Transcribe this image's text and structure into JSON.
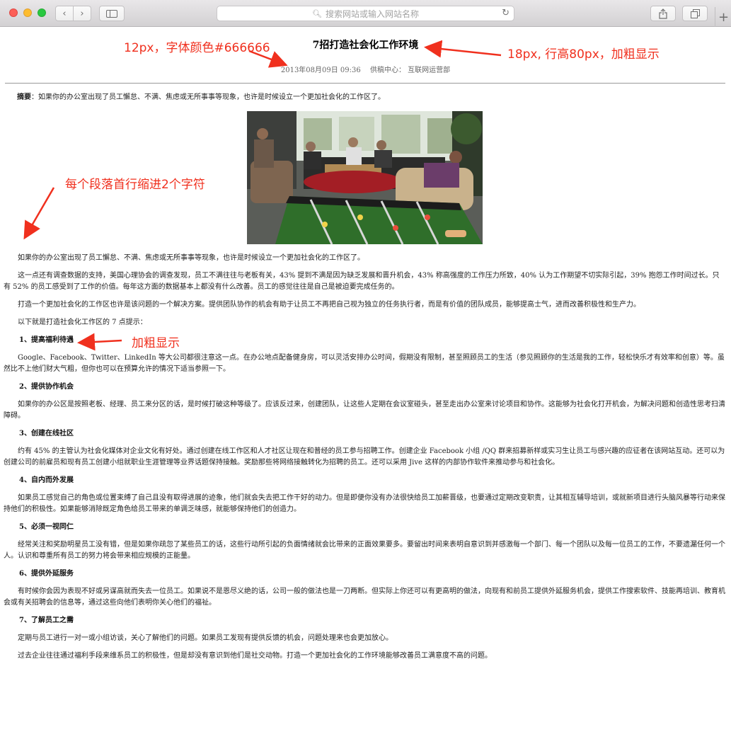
{
  "browser": {
    "url_placeholder": "搜索网站或输入网站名称",
    "icons": [
      "back-icon",
      "forward-icon",
      "sidebar-icon",
      "search-icon",
      "reload-icon",
      "share-icon",
      "tabs-icon",
      "plus-icon"
    ]
  },
  "article": {
    "title": "7招打造社会化工作环境",
    "date": "2013年08月09日 09:36",
    "source": "供稿中心：  互联网运营部",
    "abstract_label": "摘要",
    "abstract_text": "：如果你的办公室出现了员工懈怠、不满、焦虑或无所事事等现象，也许是时候设立一个更加社会化的工作区了。",
    "intro": [
      "如果你的办公室出现了员工懈怠、不满、焦虑或无所事事等现象，也许是时候设立一个更加社会化的工作区了。",
      "这一点还有调查数据的支持，美国心理协会的调查发现，员工不满往往与老板有关，43% 提到不满是因为缺乏发展和晋升机会，43% 称高强度的工作压力所致，40% 认为工作期望不切实际引起，39% 抱怨工作时间过长。只有 52% 的员工感受到了工作的价值。每年这方面的数据基本上都没有什么改善。员工的感觉往往是自己是被迫要完成任务的。",
      "打造一个更加社会化的工作区也许是该问题的一个解决方案。提供团队协作的机会有助于让员工不再把自己视为独立的任务执行者，而是有价值的团队成员，能够提高士气，进而改善积极性和生产力。",
      "以下就是打造社会化工作区的 7 点提示："
    ],
    "tips": [
      {
        "heading": "1、提高福利待遇",
        "text": "Google、Facebook、Twitter、LinkedIn 等大公司都很注意这一点。在办公地点配备健身房，可以灵活安排办公时间，假期没有限制，甚至照顾员工的生活（参见照顾你的生活是我的工作，轻松快乐才有效率和创意）等。虽然比不上他们财大气粗，但你也可以在预算允许的情况下适当参照一下。"
      },
      {
        "heading": "2、提供协作机会",
        "text": "如果你的办公区是按照老板、经理、员工来分区的话，是时候打破这种等级了。应该反过来，创建团队，让这些人定期在会议室碰头，甚至走出办公室来讨论项目和协作。这能够为社会化打开机会，为解决问题和创造性思考扫清障碍。"
      },
      {
        "heading": "3、创建在线社区",
        "text": "约有 45% 的主管认为社会化媒体对企业文化有好处。通过创建在线工作区和人才社区让现在和普经的员工参与招聘工作。创建企业 Facebook 小组 /QQ 群来招募新样或实习生让员工与感兴趣的应征者在该网站互动。还可以为创建公司的前雇员和现有员工创建小组就职业生涯管理等业界话题保持接触。奖励那些将网络接触转化为招聘的员工。还可以采用 Jive 这样的内部协作软件来推动参与和社会化。"
      },
      {
        "heading": "4、自内而外发展",
        "text": "如果员工感觉自己的角色或位置束缚了自己且没有取得进展的迹象，他们就会失去把工作干好的动力。但是即便你没有办法很快给员工加薪晋级，也要通过定期改变职责，让其相互辅导培训，或就新项目进行头脑风暴等行动来保持他们的积极性。如果能够消除既定角色给员工带来的单调乏味感，就能够保持他们的创造力。"
      },
      {
        "heading": "5、必须一视同仁",
        "text": "经常关注和奖励明星员工没有错，但是如果你疏忽了某些员工的话，这些行动所引起的负面情绪就会比带来的正面效果要多。要留出时间来表明自意识到并感激每一个部门、每一个团队以及每一位员工的工作，不要遗漏任何一个人。认识和尊重所有员工的努力将会带来相应规模的正能量。"
      },
      {
        "heading": "6、提供外延服务",
        "text": "有时候你会因为表现不好或另谋高就而失去一位员工。如果说不是恩尽义绝的话，公司一般的做法也是一刀两断。但实际上你还可以有更高明的做法，向现有和前员工提供外延服务机会，提供工作搜索软件、技能再培训、教育机会或有关招聘会的信息等，通过这些向他们表明你关心他们的福祉。"
      },
      {
        "heading": "7、了解员工之需",
        "text": "定期与员工进行一对一或小组访谈，关心了解他们的问题。如果员工发现有提供反馈的机会，问题处理来也会更加放心。"
      }
    ],
    "closing": "过去企业往往通过福利手段来维系员工的积极性，但是却没有意识到他们是社交动物。打造一个更加社会化的工作环境能够改善员工满意度不高的问题。"
  },
  "annotations": {
    "meta_note": "12px，字体颜色#666666",
    "title_note": "18px, 行高80px，加粗显示",
    "indent_note": "每个段落首行缩进2个字符",
    "bold_note": "加粗显示"
  },
  "colors": {
    "annotation": "#f0301e",
    "meta_text": "#666666"
  }
}
